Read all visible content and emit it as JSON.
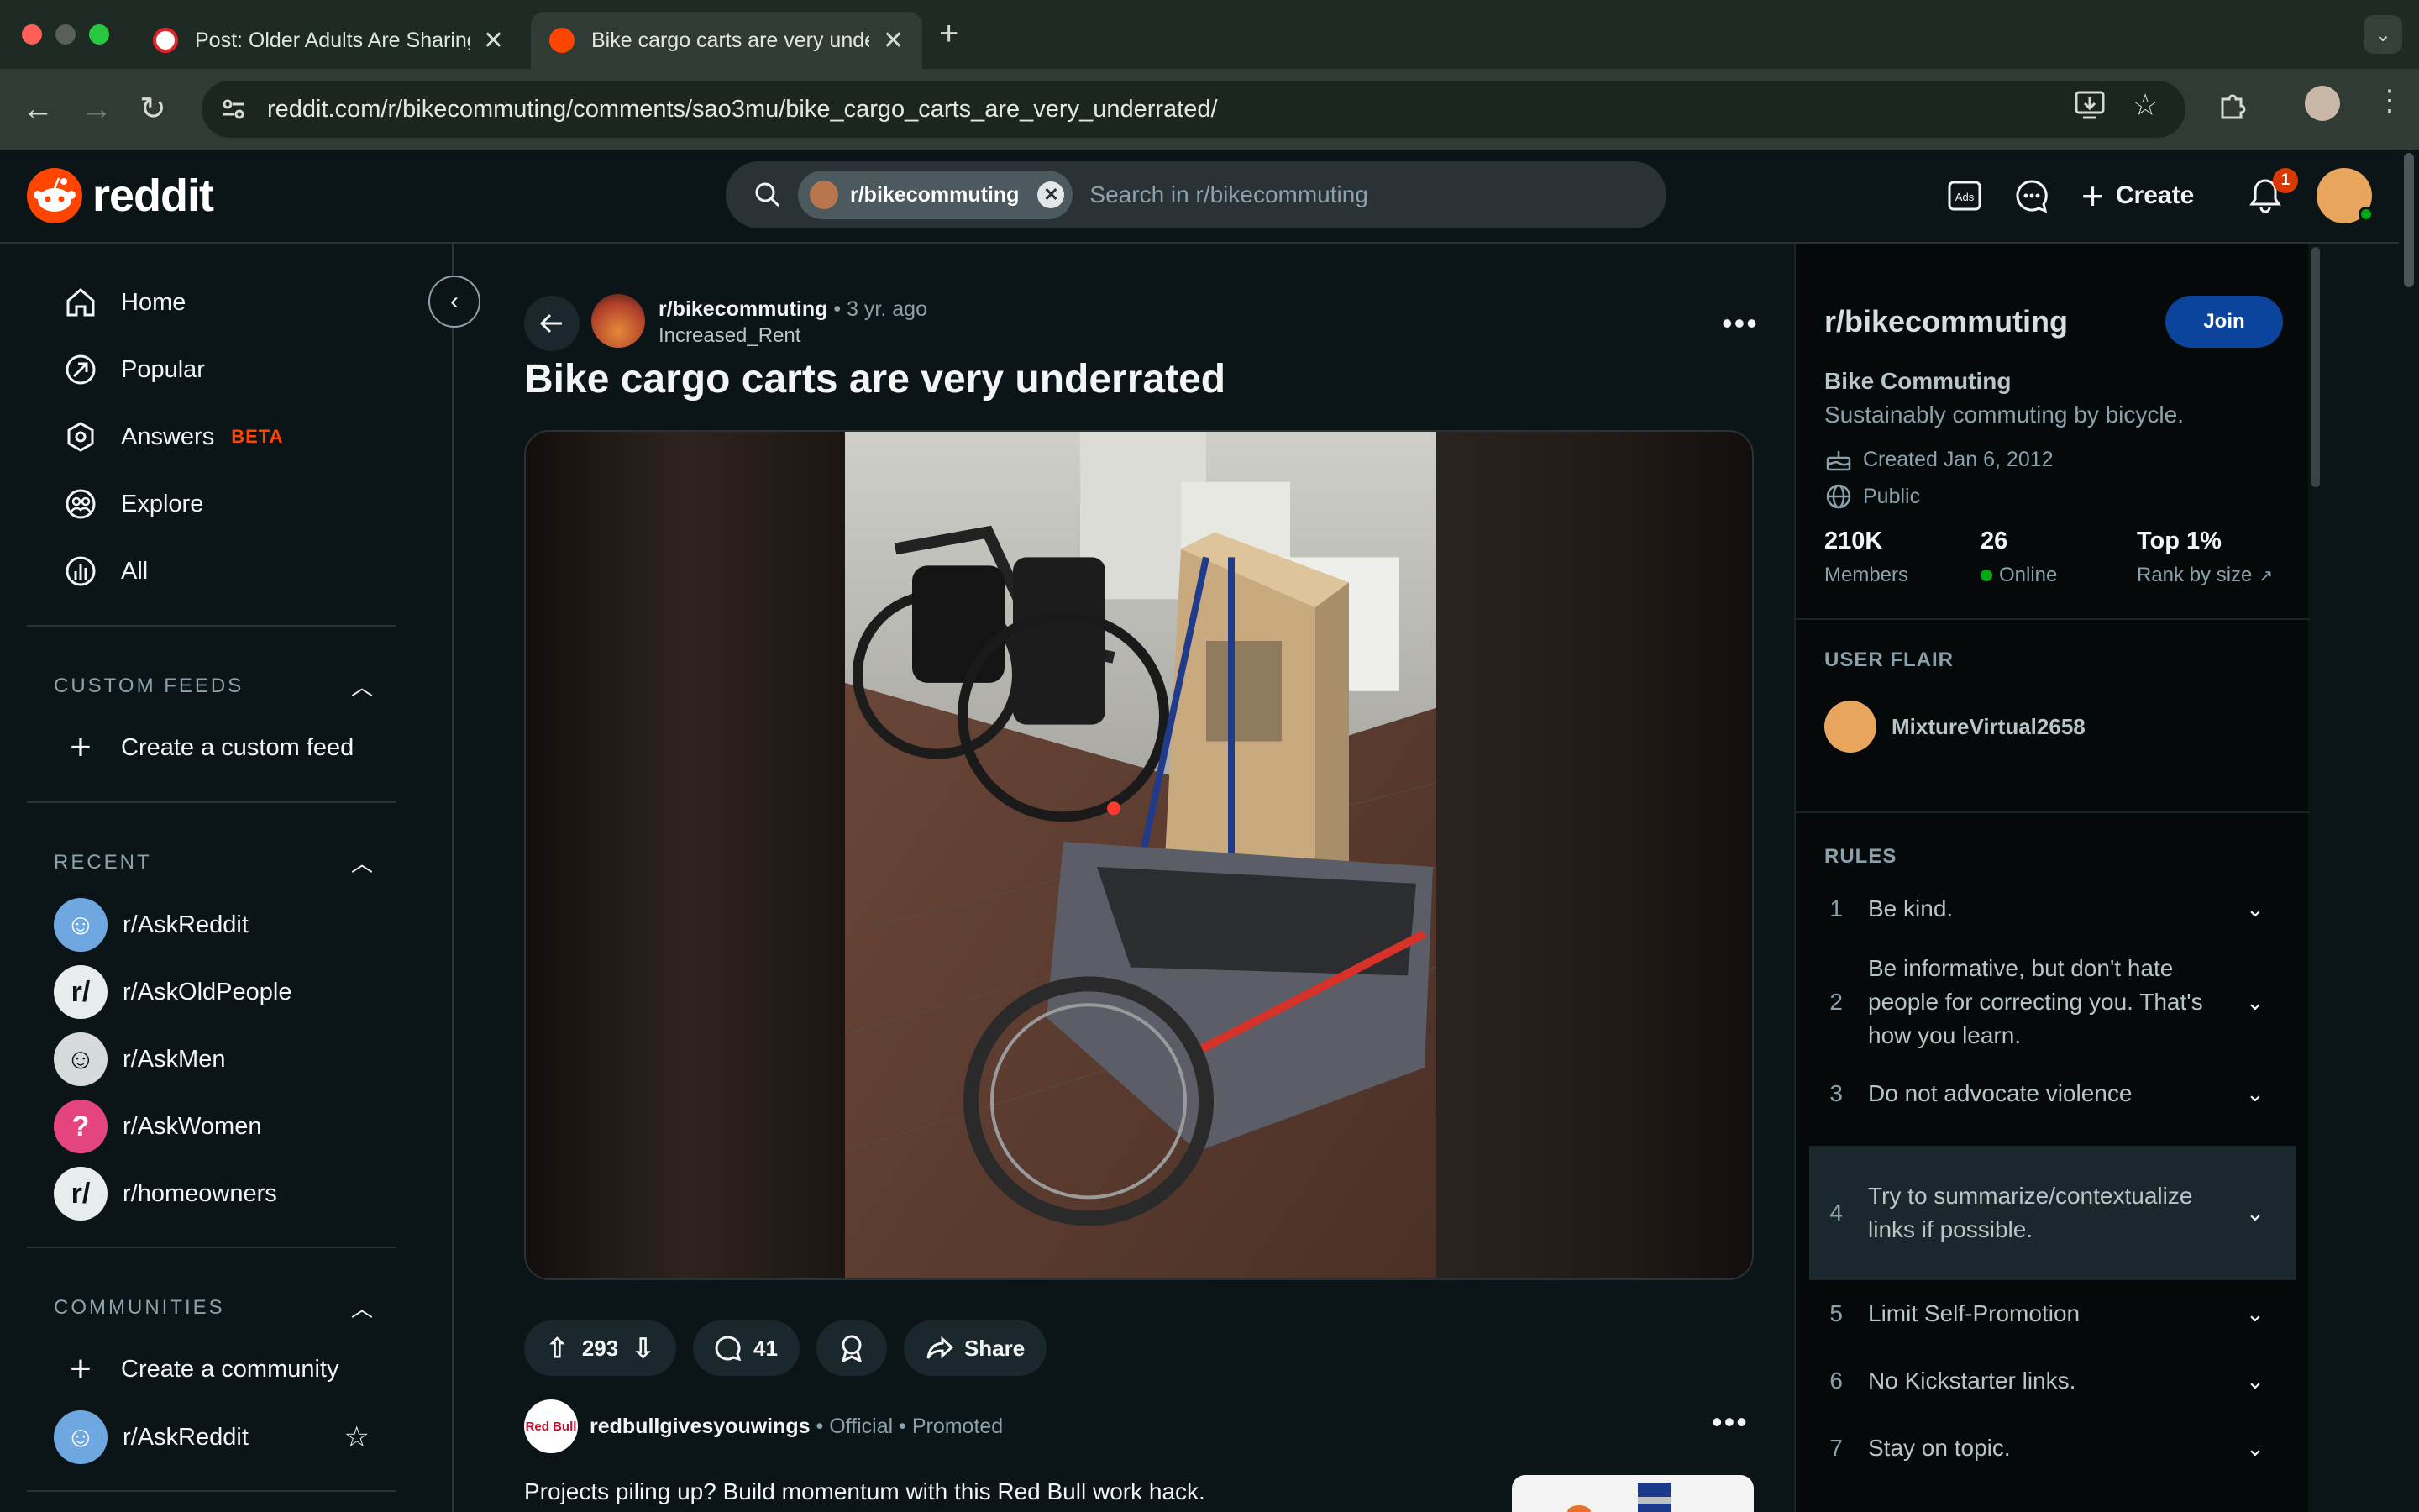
{
  "browser": {
    "tabs": [
      {
        "title": "Post: Older Adults Are Sharing",
        "close": "✕"
      },
      {
        "title": "Bike cargo carts are very underrated",
        "close": "✕"
      }
    ],
    "new_tab": "+",
    "url": "reddit.com/r/bikecommuting/comments/sao3mu/bike_cargo_carts_are_very_underrated/"
  },
  "header": {
    "logo_text": "reddit",
    "search_chip": "r/bikecommuting",
    "search_placeholder": "Search in r/bikecommuting",
    "create_label": "Create",
    "notification_count": "1"
  },
  "left_nav": {
    "items": [
      {
        "label": "Home"
      },
      {
        "label": "Popular"
      },
      {
        "label": "Answers",
        "badge": "BETA"
      },
      {
        "label": "Explore"
      },
      {
        "label": "All"
      }
    ],
    "custom_feeds": {
      "heading": "CUSTOM FEEDS",
      "create": "Create a custom feed"
    },
    "recent": {
      "heading": "RECENT",
      "items": [
        "r/AskReddit",
        "r/AskOldPeople",
        "r/AskMen",
        "r/AskWomen",
        "r/homeowners"
      ]
    },
    "communities": {
      "heading": "COMMUNITIES",
      "create": "Create a community",
      "items": [
        "r/AskReddit"
      ]
    }
  },
  "post": {
    "subreddit": "r/bikecommuting",
    "time": "• 3 yr. ago",
    "author": "Increased_Rent",
    "title": "Bike cargo carts are very underrated",
    "upvotes": "293",
    "comments": "41",
    "share": "Share"
  },
  "promo": {
    "advertiser": "redbullgivesyouwings",
    "official": "• Official •",
    "promoted": "Promoted",
    "avatar_text": "Red Bull",
    "text": "Projects piling up? Build momentum with this Red Bull work hack."
  },
  "sidebar": {
    "title": "r/bikecommuting",
    "join": "Join",
    "name": "Bike Commuting",
    "description": "Sustainably commuting by bicycle.",
    "created": "Created Jan 6, 2012",
    "visibility": "Public",
    "stats": [
      {
        "value": "210K",
        "label": "Members"
      },
      {
        "value": "26",
        "label": "Online"
      },
      {
        "value": "Top 1%",
        "label": "Rank by size"
      }
    ],
    "user_flair_heading": "USER FLAIR",
    "user_flair_name": "MixtureVirtual2658",
    "rules_heading": "RULES",
    "rules": [
      {
        "num": "1",
        "text": "Be kind."
      },
      {
        "num": "2",
        "text": "Be informative, but don't hate people for correcting you. That's how you learn."
      },
      {
        "num": "3",
        "text": "Do not advocate violence"
      },
      {
        "num": "4",
        "text": "Try to summarize/contextualize links if possible."
      },
      {
        "num": "5",
        "text": "Limit Self-Promotion"
      },
      {
        "num": "6",
        "text": "No Kickstarter links."
      },
      {
        "num": "7",
        "text": "Stay on topic."
      }
    ]
  },
  "colors": {
    "background": "#0b1416",
    "accent": "#ff4500",
    "join_button": "#0a449b",
    "online_dot": "#01a816"
  }
}
